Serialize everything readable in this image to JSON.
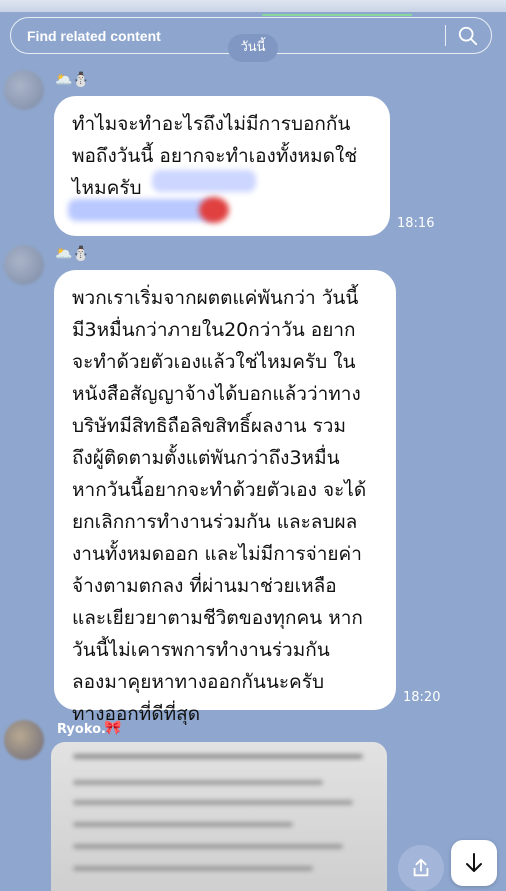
{
  "search": {
    "placeholder": "Find related content"
  },
  "date_chip": "วันนี้",
  "messages": [
    {
      "sender_emoji": "🌥️⛄",
      "text": "ทำไมจะทำอะไรถึงไม่มีการบอกกัน\nพอถึงวันนี้ อยากจะทำเองทั้งหมดใช่\nไหมครับ",
      "time": "18:16"
    },
    {
      "sender_emoji": "🌥️⛄",
      "text": "พวกเราเริ่มจากผตตแค่พันกว่า วันนี้\nมี3หมื่นกว่าภายใน20กว่าวัน อยาก\nจะทำด้วยตัวเองแล้วใช่ไหมครับ ใน\nหนังสือสัญญาจ้างได้บอกแล้วว่าทาง\nบริษัทมีสิทธิถือลิขสิทธิ์ผลงาน รวม\nถึงผู้ติดตามตั้งแต่พันกว่าถึง3หมื่น\nหากวันนี้อยากจะทำด้วยตัวเอง จะได้\nยกเลิกการทำงานร่วมกัน และลบผล\nงานทั้งหมดออก และไม่มีการจ่ายค่า\nจ้างตามตกลง ที่ผ่านมาช่วยเหลือ\nและเยียวยาตามชีวิตของทุกคน หาก\nวันนี้ไม่เคารพการทำงานร่วมกัน\nลองมาคุยหาทางออกกันนะครับ\nทางออกที่ดีที่สุด",
      "time": "18:20"
    },
    {
      "sender_name": "Ryoko.",
      "sender_emoji": "🎀"
    }
  ],
  "icons": {
    "search": "search-icon",
    "share": "share-icon",
    "scroll_down": "arrow-down-icon"
  }
}
